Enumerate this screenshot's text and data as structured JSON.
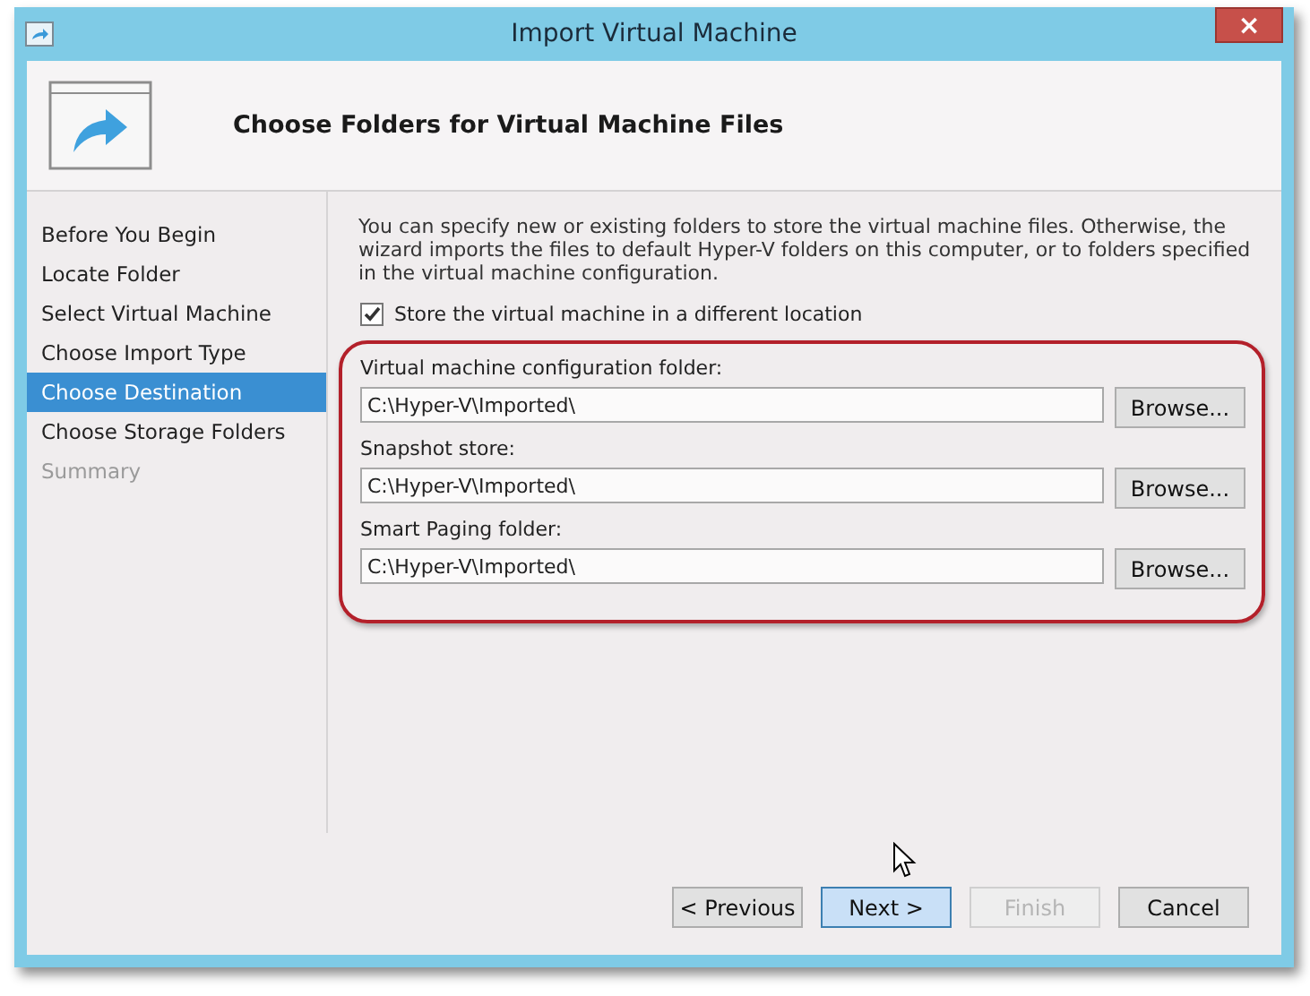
{
  "window": {
    "title": "Import Virtual Machine",
    "close": "×"
  },
  "header": {
    "title": "Choose Folders for Virtual Machine Files"
  },
  "steps": [
    {
      "label": "Before You Begin",
      "selected": false,
      "disabled": false
    },
    {
      "label": "Locate Folder",
      "selected": false,
      "disabled": false
    },
    {
      "label": "Select Virtual Machine",
      "selected": false,
      "disabled": false
    },
    {
      "label": "Choose Import Type",
      "selected": false,
      "disabled": false
    },
    {
      "label": "Choose Destination",
      "selected": true,
      "disabled": false
    },
    {
      "label": "Choose Storage Folders",
      "selected": false,
      "disabled": false
    },
    {
      "label": "Summary",
      "selected": false,
      "disabled": true
    }
  ],
  "description": "You can specify new or existing folders to store the virtual machine files. Otherwise, the wizard imports the files to default Hyper-V folders on this computer, or to folders specified in the virtual machine configuration.",
  "store_elsewhere": {
    "label": "Store the virtual machine in a different location",
    "checked": true
  },
  "folders": [
    {
      "label": "Virtual machine configuration folder:",
      "value": "C:\\Hyper-V\\Imported\\",
      "button": "Browse..."
    },
    {
      "label": "Snapshot store:",
      "value": "C:\\Hyper-V\\Imported\\",
      "button": "Browse..."
    },
    {
      "label": "Smart Paging folder:",
      "value": "C:\\Hyper-V\\Imported\\",
      "button": "Browse..."
    }
  ],
  "buttons": [
    {
      "label": "< Previous",
      "disabled": false,
      "highlighted": false
    },
    {
      "label": "Next >",
      "disabled": false,
      "highlighted": true
    },
    {
      "label": "Finish",
      "disabled": true,
      "highlighted": false
    },
    {
      "label": "Cancel",
      "disabled": false,
      "highlighted": false
    }
  ]
}
